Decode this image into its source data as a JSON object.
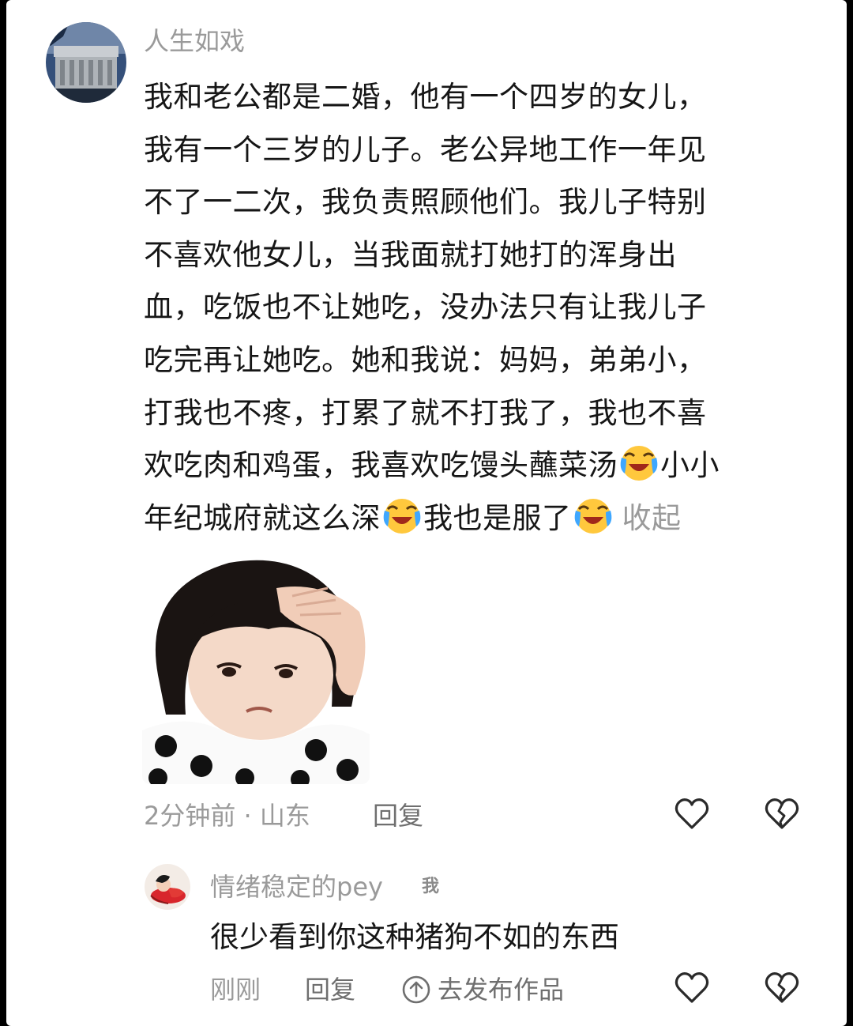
{
  "comment": {
    "username": "人生如戏",
    "lines": [
      "我和老公都是二婚，他有一个四岁的女儿，",
      "我有一个三岁的儿子。老公异地工作一年见",
      "不了一二次，我负责照顾他们。我儿子特别",
      "不喜欢他女儿，当我面就打她打的浑身出",
      "血，吃饭也不让她吃，没办法只有让我儿子",
      "吃完再让她吃。她和我说：妈妈，弟弟小，",
      "打我也不疼，打累了就不打我了，我也不喜"
    ],
    "line8_pre": "欢吃肉和鸡蛋，我喜欢吃馒头蘸菜汤",
    "line8_post": "小小",
    "line9_a": "年纪城府就这么深",
    "line9_b": "我也是服了",
    "collapse_label": "收起",
    "time_location": "2分钟前 · 山东",
    "reply_label": "回复",
    "emoji_icon": "laughing-crying-emoji",
    "sticker_icon": "sad-girl-sticker"
  },
  "reply": {
    "username": "情绪稳定的pey",
    "me_badge": "我",
    "text": "很少看到你这种猪狗不如的东西",
    "time": "刚刚",
    "reply_label": "回复",
    "publish_label": "去发布作品"
  },
  "colors": {
    "background": "#ffffff",
    "text": "#161616",
    "muted": "#9a9a9a"
  }
}
